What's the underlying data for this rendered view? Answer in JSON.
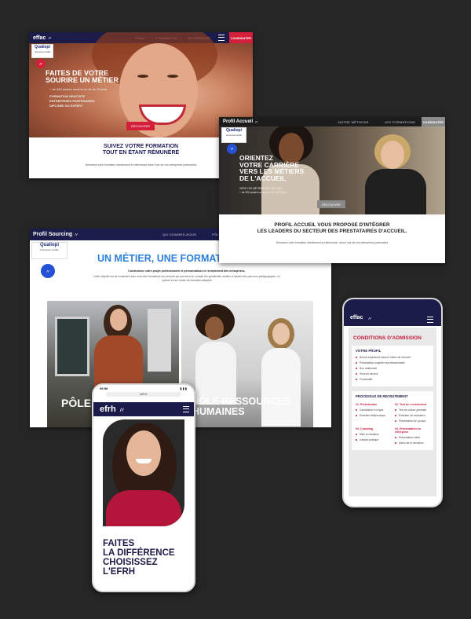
{
  "effac_desktop": {
    "brand": "effac",
    "nav": [
      "Pôle",
      "Formation",
      "Entreprise"
    ],
    "cta": "Candidater",
    "badge_title": "Qualiopi",
    "badge_sub": "processus certifié",
    "headline": [
      "Faites de votre",
      "sourire un métier"
    ],
    "offer_line": "+ de 400 postes ouverts en île-de-France",
    "bullets": [
      "Formation gratuite",
      "Entreprises partenaires",
      "Diplôme ou expert"
    ],
    "button": "Découvrir",
    "subtitle": [
      "Suivez votre formation",
      "tout en étant rémunéré"
    ],
    "body": "Démarrez votre formation directement en alternance dans l'une de nos entreprises partenaires"
  },
  "profil_accueil": {
    "brand": "Profil Accueil",
    "nav": [
      "Notre méthode",
      "Les formations"
    ],
    "cta": "Candidater",
    "badge_title": "Qualiopi",
    "badge_sub": "processus certifié",
    "headline": [
      "Orientez",
      "votre carrière",
      "vers les métiers",
      "de l'accueil"
    ],
    "small": [
      "Vers les métiers de l'accueil",
      "+ de 300 postes ouverts en île-de-France"
    ],
    "button": "Découvrir",
    "subtitle": [
      "Profil accueil vous propose d'intégrer",
      "les leaders du secteur des prestataires d'accueil."
    ],
    "body": "Démarrez votre formation directement en alternance, dans l'une de nos entreprises partenaires"
  },
  "profil_sourcing": {
    "brand": "Profil Sourcing",
    "nav": [
      "Qui sommes-nous",
      "Pôle"
    ],
    "badge_title": "Qualiopi",
    "badge_sub": "processus certifié",
    "headline": "Un métier, une formation,",
    "intro_bold": "Construisez votre projet professionnel et personnalisez le recrutement des entreprises.",
    "intro": "Notre objectif est de construire avec vous des formations sur-mesure qui prennent en compte les spécificités métiers à travers des parcours pédagogiques, un rythme et une durée de formation adaptés",
    "panel_left": "Pôle",
    "panel_right": [
      "Pôle ressources",
      "humaines"
    ]
  },
  "efrh_phone": {
    "time": "09:58",
    "url": "efrh.fr",
    "brand": "efrh",
    "headline": [
      "Faites",
      "la différence",
      "choisissez",
      "l'EFRH"
    ]
  },
  "effac_phone": {
    "brand": "effac",
    "title": "Conditions d'admission",
    "profile_title": "Votre profil",
    "profile_items": [
      "Bonne expérience dans le milieu de l'accueil",
      "Présentation soignée et professionnelle",
      "Bon relationnel",
      "Sens du service",
      "Ponctualité"
    ],
    "process_title": "Processus de recrutement",
    "steps": [
      {
        "title": "01. Présélection",
        "items": [
          "Candidature en ligne",
          "Entretien téléphonique"
        ]
      },
      {
        "title": "02. Test de recrutement",
        "items": [
          "Test de culture générale",
          "Entretien de motivation",
          "Présentation de groupe"
        ]
      },
      {
        "title": "03. Coaching",
        "items": [
          "Mise en situation",
          "Gestion pratique"
        ]
      },
      {
        "title": "04. Présentation en entreprise",
        "items": [
          "Présentation client",
          "Début de la formation"
        ]
      }
    ]
  },
  "colors": {
    "navy": "#1c1c4a",
    "red": "#d31f3a",
    "blue": "#2d7fd9",
    "background": "#262626"
  }
}
